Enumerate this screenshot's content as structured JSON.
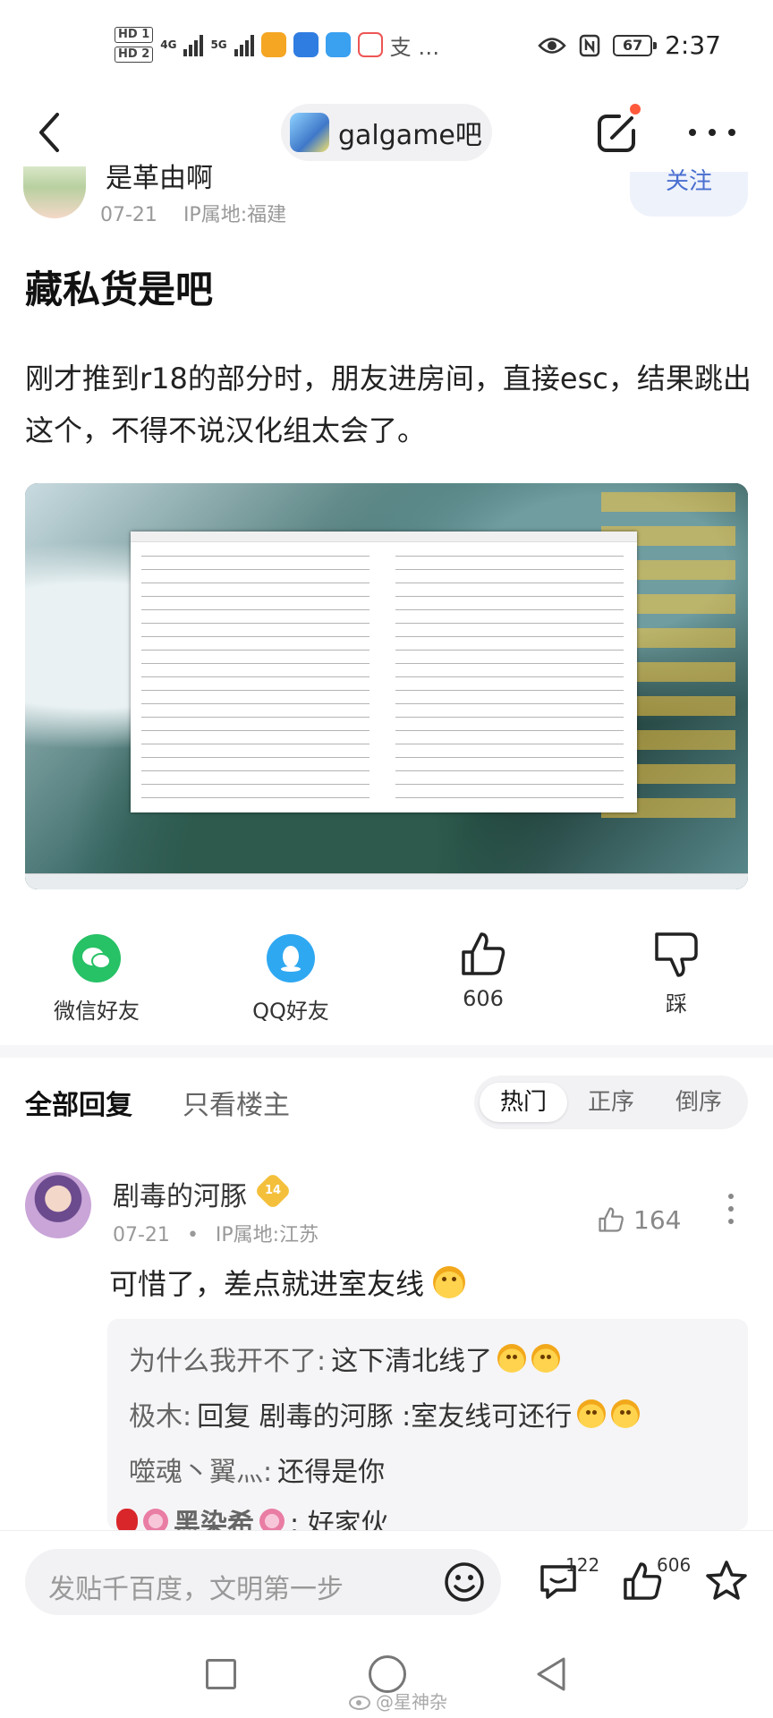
{
  "status_bar": {
    "hd1": "HD 1",
    "hd2": "HD 2",
    "net1": "4G",
    "net2": "5G",
    "extra_text": "支 …",
    "battery": "67",
    "time": "2:37"
  },
  "nav": {
    "forum_name": "galgame吧"
  },
  "author": {
    "name": "是革由啊",
    "date": "07-21",
    "ip": "IP属地:福建",
    "follow_label": "关注"
  },
  "post": {
    "title": "藏私货是吧",
    "body": "刚才推到r18的部分时，朋友进房间，直接esc，结果跳出这个，不得不说汉化组太会了。"
  },
  "share": {
    "wechat": "微信好友",
    "qq": "QQ好友",
    "like_count": "606",
    "dislike": "踩"
  },
  "replies_header": {
    "all": "全部回复",
    "op_only": "只看楼主",
    "sort_hot": "热门",
    "sort_asc": "正序",
    "sort_desc": "倒序"
  },
  "reply": {
    "name": "剧毒的河豚",
    "level": "14",
    "date": "07-21",
    "separator": "•",
    "ip": "IP属地:江苏",
    "likes": "164",
    "text": "可惜了，差点就进室友线",
    "subreplies": [
      {
        "name": "为什么我开不了:",
        "text": "这下清北线了"
      },
      {
        "name": "极木:",
        "text": "回复 剧毒的河豚 :室友线可还行"
      },
      {
        "name": "噬魂丶翼灬:",
        "text": "还得是你"
      },
      {
        "name": "黑染希",
        "text": ": 好家伙"
      }
    ]
  },
  "bottom_bar": {
    "placeholder": "发贴千百度，文明第一步",
    "comment_count": "122",
    "like_count": "606"
  },
  "watermark": "@星神杂"
}
